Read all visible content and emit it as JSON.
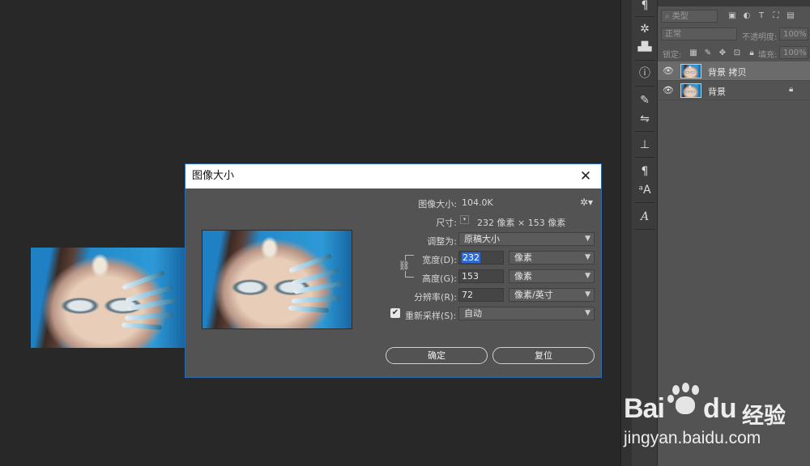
{
  "dialog": {
    "title": "图像大小",
    "close_glyph": "✕",
    "image_size_label": "图像大小:",
    "image_size_value": "104.0K",
    "dimensions_label": "尺寸:",
    "dimensions_value": "232 像素 × 153 像素",
    "fit_to_label": "调整为:",
    "fit_to_value": "原稿大小",
    "width_label": "宽度(D):",
    "width_value": "232",
    "width_unit": "像素",
    "height_label": "高度(G):",
    "height_value": "153",
    "height_unit": "像素",
    "resolution_label": "分辨率(R):",
    "resolution_value": "72",
    "resolution_unit": "像素/英寸",
    "resample_label": "重新采样(S):",
    "resample_checked": true,
    "resample_value": "自动",
    "ok_label": "确定",
    "reset_label": "复位"
  },
  "layers_panel": {
    "filter_kind": "类型",
    "blend_mode": "正常",
    "opacity_label": "不透明度:",
    "opacity_value": "100%",
    "lock_label": "锁定:",
    "fill_label": "填充:",
    "fill_value": "100%",
    "layers": [
      {
        "name": "背景 拷贝",
        "visible": true,
        "selected": true,
        "locked": false
      },
      {
        "name": "背景",
        "visible": true,
        "selected": false,
        "locked": true
      }
    ]
  },
  "toolbar_icons": [
    "paragraph-icon",
    "brush-settings-icon",
    "histogram-icon",
    "info-icon",
    "brush-presets-icon",
    "adjustments-icon",
    "clone-source-icon",
    "character-styles-icon",
    "glyphs-icon",
    "type-icon"
  ],
  "watermark": {
    "brand_bai": "Bai",
    "brand_du": "du",
    "brand_cn": "经验",
    "url": "jingyan.baidu.com"
  }
}
